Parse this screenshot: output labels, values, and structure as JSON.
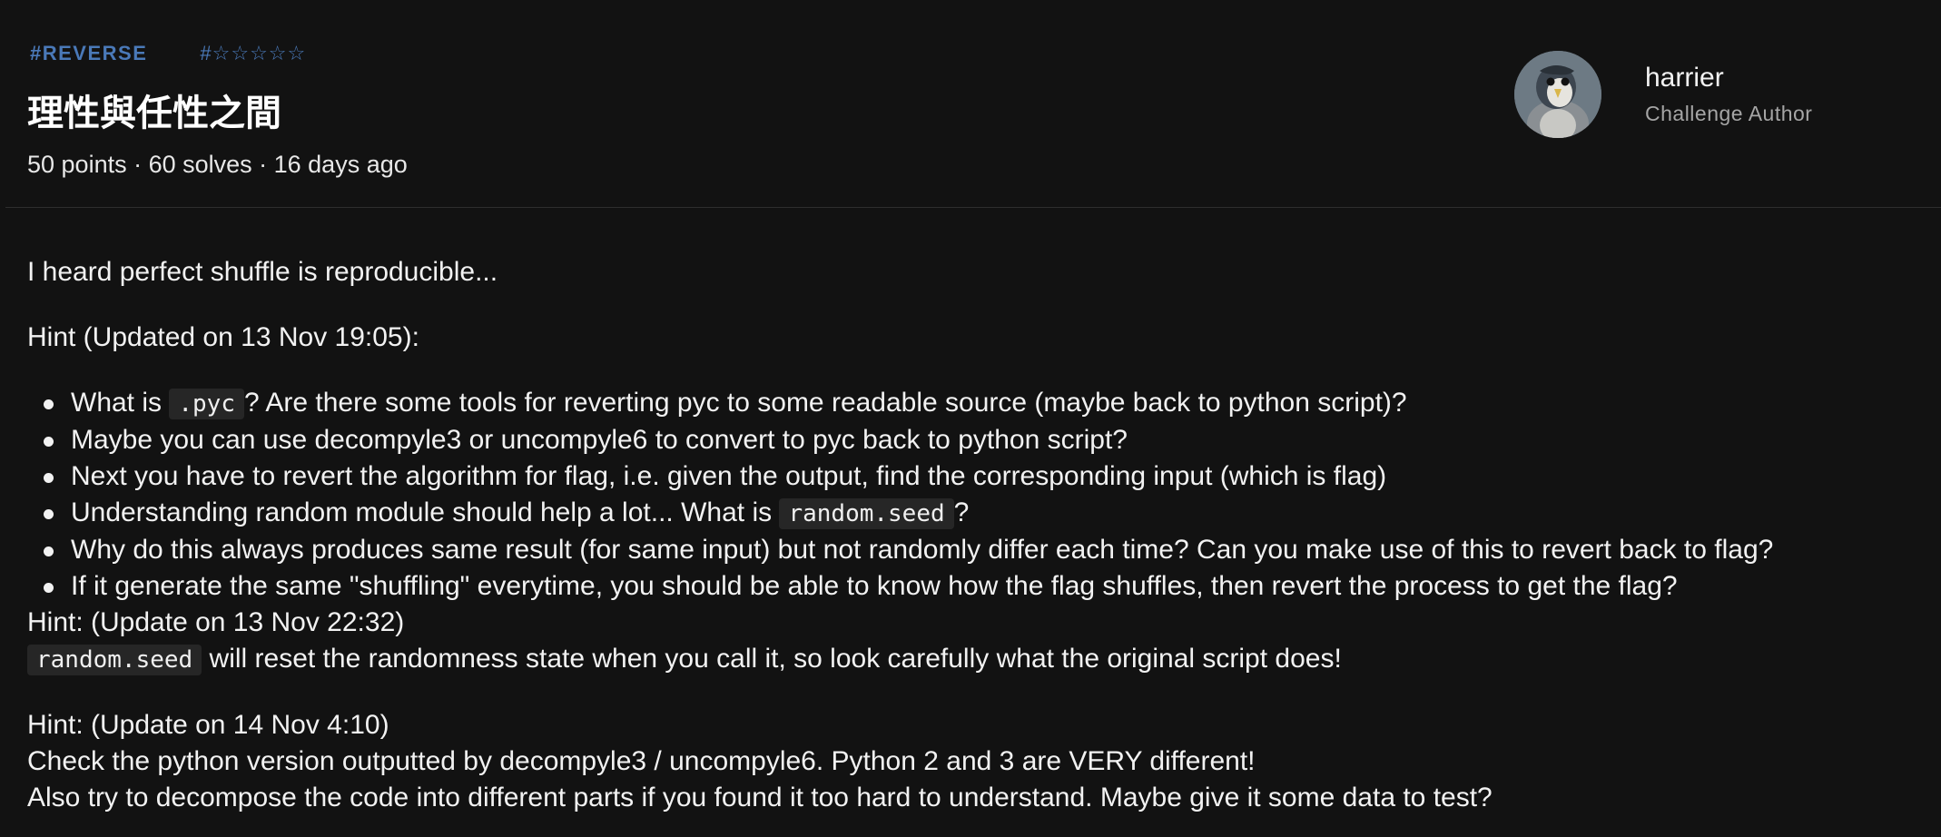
{
  "challenge": {
    "category_tag": "#REVERSE",
    "difficulty_tag": "#☆☆☆☆☆",
    "title": "理性與任性之間",
    "meta": "50 points · 60 solves · 16 days ago"
  },
  "author": {
    "name": "harrier",
    "role": "Challenge Author"
  },
  "description": {
    "intro": "I heard perfect shuffle is reproducible...",
    "hint1_title": "Hint (Updated on 13 Nov 19:05):",
    "hint1_items": [
      {
        "before": "What is ",
        "code": ".pyc",
        "after": "? Are there some tools for reverting pyc to some readable source (maybe back to python script)?"
      },
      {
        "text": "Maybe you can use decompyle3 or uncompyle6 to convert to pyc back to python script?"
      },
      {
        "text": "Next you have to revert the algorithm for flag, i.e. given the output, find the corresponding input (which is flag)"
      },
      {
        "before": "Understanding random module should help a lot... What is ",
        "code": "random.seed",
        "after": "?"
      },
      {
        "text": "Why do this always produces same result (for same input) but not randomly differ each time? Can you make use of this to revert back to flag?"
      },
      {
        "text": "If it generate the same \"shuffling\" everytime, you should be able to know how the flag shuffles, then revert the process to get the flag?"
      }
    ],
    "hint2_title": "Hint: (Update on 13 Nov 22:32)",
    "hint2_code": "random.seed",
    "hint2_text": " will reset the randomness state when you call it, so look carefully what the original script does!",
    "hint3_title": "Hint: (Update on 14 Nov 4:10)",
    "hint3_line1": "Check the python version outputted by decompyle3 / uncompyle6. Python 2 and 3 are VERY different!",
    "hint3_line2": "Also try to decompose the code into different parts if you found it too hard to understand. Maybe give it some data to test?"
  },
  "colors": {
    "background": "#121212",
    "tag_accent": "#4a79b8",
    "code_background": "#262626"
  }
}
